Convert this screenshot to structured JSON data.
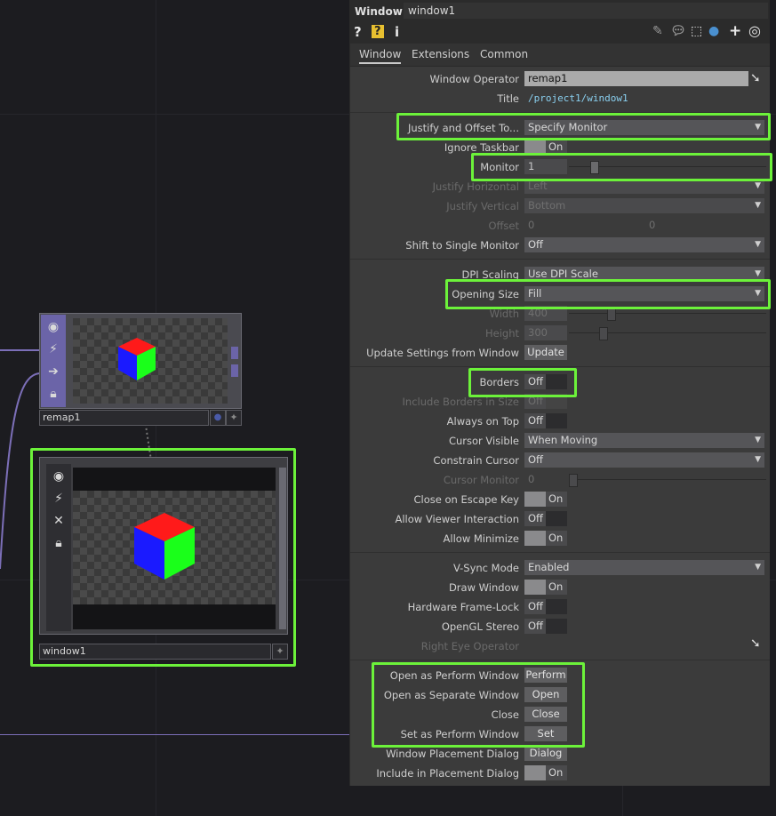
{
  "colors": {
    "highlight": "#6cf23a",
    "wire": "#7c6fb8",
    "panel": "#3b3b3b"
  },
  "network": {
    "nodes": [
      {
        "name": "remap1",
        "icons": [
          "viewer-toggle-icon",
          "cook-icon",
          "arrow-right-icon",
          "lock-icon"
        ]
      },
      {
        "name": "window1",
        "icons": [
          "viewer-toggle-icon",
          "cook-icon",
          "bypass-x-icon",
          "lock-icon"
        ]
      }
    ]
  },
  "panel": {
    "title_type": "Window",
    "title_name": "window1",
    "toolbar": [
      "help-icon",
      "help-operator-icon",
      "info-icon",
      "edit-icon",
      "comment-icon",
      "clone-icon",
      "python-icon",
      "add-icon",
      "target-icon"
    ],
    "tabs": [
      "Window",
      "Extensions",
      "Common"
    ],
    "params": {
      "window_operator": {
        "label": "Window Operator",
        "value": "remap1"
      },
      "title": {
        "label": "Title",
        "value": "/project1/window1"
      },
      "justify_offset": {
        "label": "Justify and Offset To...",
        "value": "Specify Monitor"
      },
      "ignore_taskbar": {
        "label": "Ignore Taskbar",
        "value": "On"
      },
      "monitor": {
        "label": "Monitor",
        "value": "1"
      },
      "justify_h": {
        "label": "Justify Horizontal",
        "value": "Left"
      },
      "justify_v": {
        "label": "Justify Vertical",
        "value": "Bottom"
      },
      "offset": {
        "label": "Offset",
        "x": "0",
        "y": "0"
      },
      "shift_single": {
        "label": "Shift to Single Monitor",
        "value": "Off"
      },
      "dpi_scaling": {
        "label": "DPI Scaling",
        "value": "Use DPI Scale"
      },
      "opening_size": {
        "label": "Opening Size",
        "value": "Fill"
      },
      "width": {
        "label": "Width",
        "value": "400"
      },
      "height": {
        "label": "Height",
        "value": "300"
      },
      "update_settings": {
        "label": "Update Settings from Window",
        "value": "Update"
      },
      "borders": {
        "label": "Borders",
        "value": "Off"
      },
      "include_borders": {
        "label": "Include Borders in Size",
        "value": "Off"
      },
      "always_on_top": {
        "label": "Always on Top",
        "value": "Off"
      },
      "cursor_visible": {
        "label": "Cursor Visible",
        "value": "When Moving"
      },
      "constrain_cursor": {
        "label": "Constrain Cursor",
        "value": "Off"
      },
      "cursor_monitor": {
        "label": "Cursor Monitor",
        "value": "0"
      },
      "close_escape": {
        "label": "Close on Escape Key",
        "value": "On"
      },
      "allow_viewer": {
        "label": "Allow Viewer Interaction",
        "value": "Off"
      },
      "allow_minimize": {
        "label": "Allow Minimize",
        "value": "On"
      },
      "vsync": {
        "label": "V-Sync Mode",
        "value": "Enabled"
      },
      "draw_window": {
        "label": "Draw Window",
        "value": "On"
      },
      "hw_framelock": {
        "label": "Hardware Frame-Lock",
        "value": "Off"
      },
      "opengl_stereo": {
        "label": "OpenGL Stereo",
        "value": "Off"
      },
      "right_eye": {
        "label": "Right Eye Operator"
      },
      "open_perform": {
        "label": "Open as Perform Window",
        "value": "Perform"
      },
      "open_separate": {
        "label": "Open as Separate Window",
        "value": "Open"
      },
      "close": {
        "label": "Close",
        "value": "Close"
      },
      "set_perform": {
        "label": "Set as Perform Window",
        "value": "Set"
      },
      "placement_dialog": {
        "label": "Window Placement Dialog",
        "value": "Dialog"
      },
      "include_placement": {
        "label": "Include in Placement Dialog",
        "value": "On"
      }
    }
  }
}
